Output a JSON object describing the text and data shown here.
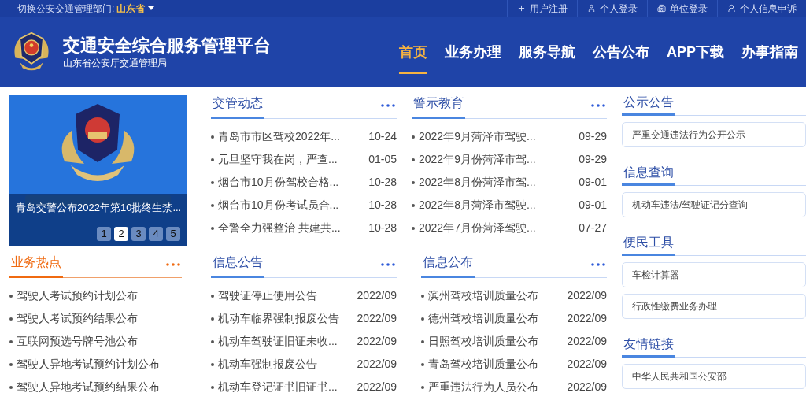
{
  "top_bar": {
    "switch_label": "切换公安交通管理部门:",
    "region": "山东省",
    "links": [
      "用户注册",
      "个人登录",
      "单位登录",
      "个人信息申诉"
    ]
  },
  "header": {
    "title": "交通安全综合服务管理平台",
    "subtitle": "山东省公安厅交通管理局",
    "nav": [
      {
        "label": "首页",
        "selected": true
      },
      {
        "label": "业务办理",
        "selected": false
      },
      {
        "label": "服务导航",
        "selected": false
      },
      {
        "label": "公告公布",
        "selected": false
      },
      {
        "label": "APP下载",
        "selected": false
      },
      {
        "label": "办事指南",
        "selected": false
      }
    ]
  },
  "carousel": {
    "caption": "青岛交警公布2022年第10批终生禁...",
    "pages": [
      {
        "label": "1",
        "selected": false
      },
      {
        "label": "2",
        "selected": true
      },
      {
        "label": "3",
        "selected": false
      },
      {
        "label": "4",
        "selected": false
      },
      {
        "label": "5",
        "selected": false
      }
    ]
  },
  "panels": [
    {
      "title": "交管动态",
      "kind": "normal",
      "items": [
        {
          "title": "青岛市市区驾校2022年...",
          "date": "10-24"
        },
        {
          "title": "元旦坚守我在岗，严查...",
          "date": "01-05"
        },
        {
          "title": "烟台市10月份驾校合格...",
          "date": "10-28"
        },
        {
          "title": "烟台市10月份考试员合...",
          "date": "10-28"
        },
        {
          "title": "全警全力强整治 共建共...",
          "date": "10-28"
        }
      ]
    },
    {
      "title": "警示教育",
      "kind": "normal",
      "items": [
        {
          "title": "2022年9月菏泽市驾驶...",
          "date": "09-29"
        },
        {
          "title": "2022年9月份菏泽市驾...",
          "date": "09-29"
        },
        {
          "title": "2022年8月份菏泽市驾...",
          "date": "09-01"
        },
        {
          "title": "2022年8月菏泽市驾驶...",
          "date": "09-01"
        },
        {
          "title": "2022年7月份菏泽驾驶...",
          "date": "07-27"
        }
      ]
    },
    {
      "title": "业务热点",
      "kind": "hot",
      "items": [
        {
          "title": "驾驶人考试预约计划公布"
        },
        {
          "title": "驾驶人考试预约结果公布"
        },
        {
          "title": "互联网预选号牌号池公布"
        },
        {
          "title": "驾驶人异地考试预约计划公布"
        },
        {
          "title": "驾驶人异地考试预约结果公布"
        }
      ]
    },
    {
      "title": "信息公告",
      "kind": "normal",
      "items": [
        {
          "title": "驾驶证停止使用公告",
          "date": "2022/09"
        },
        {
          "title": "机动车临界强制报废公告",
          "date": "2022/09"
        },
        {
          "title": "机动车驾驶证旧证未收...",
          "date": "2022/09"
        },
        {
          "title": "机动车强制报废公告",
          "date": "2022/09"
        },
        {
          "title": "机动车登记证书旧证书...",
          "date": "2022/09"
        }
      ]
    },
    {
      "title": "信息公布",
      "kind": "normal",
      "items": [
        {
          "title": "滨州驾校培训质量公布",
          "date": "2022/09"
        },
        {
          "title": "德州驾校培训质量公布",
          "date": "2022/09"
        },
        {
          "title": "日照驾校培训质量公布",
          "date": "2022/09"
        },
        {
          "title": "青岛驾校培训质量公布",
          "date": "2022/09"
        },
        {
          "title": "严重违法行为人员公布",
          "date": "2022/09"
        }
      ]
    }
  ],
  "sidebar": [
    {
      "title": "公示公告",
      "links": [
        "严重交通违法行为公开公示"
      ]
    },
    {
      "title": "信息查询",
      "links": [
        "机动车违法/驾驶证记分查询"
      ]
    },
    {
      "title": "便民工具",
      "links": [
        "车检计算器",
        "行政性缴费业务办理"
      ]
    },
    {
      "title": "友情链接",
      "links": [
        "中华人民共和国公安部"
      ]
    }
  ]
}
